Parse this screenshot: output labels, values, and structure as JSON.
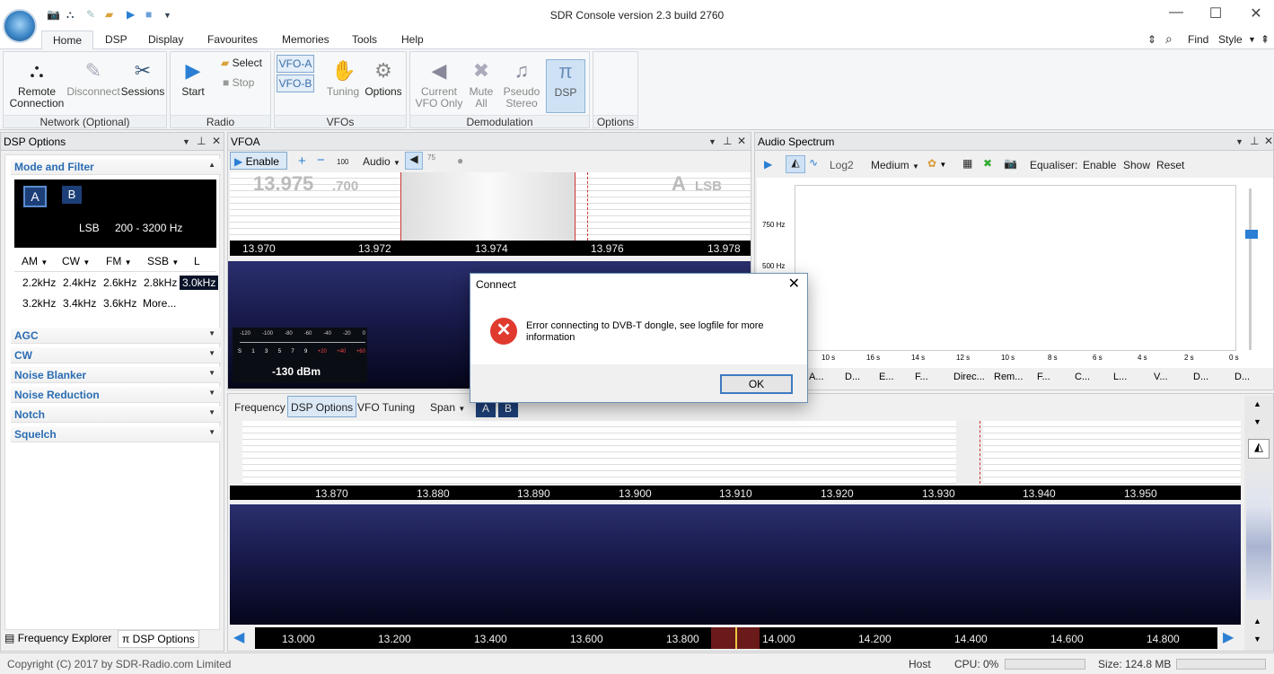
{
  "window": {
    "title": "SDR Console version 2.3 build 2760"
  },
  "quick_access": [
    "camera-icon",
    "network-icon",
    "plug-icon",
    "folder-icon",
    "play-icon",
    "stop-icon",
    "dropdown-icon"
  ],
  "window_controls": {
    "minimize": "—",
    "maximize": "☐",
    "close": "✕"
  },
  "menu": {
    "items": [
      "Home",
      "DSP",
      "Display",
      "Favourites",
      "Memories",
      "Tools",
      "Help"
    ],
    "active": "Home"
  },
  "ribbon_tools": {
    "find": "Find",
    "style": "Style"
  },
  "ribbon": {
    "network": {
      "label": "Network (Optional)",
      "remote": "Remote\nConnection",
      "disconnect": "Disconnect",
      "sessions": "Sessions"
    },
    "radio": {
      "label": "Radio",
      "start": "Start",
      "select": "Select",
      "stop": "Stop"
    },
    "vfos": {
      "label": "VFOs",
      "vfo_a": "VFO-A",
      "vfo_b": "VFO-B",
      "tuning": "Tuning",
      "options": "Options"
    },
    "demod": {
      "label": "Demodulation",
      "current": "Current\nVFO Only",
      "mute": "Mute\nAll",
      "pseudo": "Pseudo\nStereo"
    },
    "dsp": {
      "label": "DSP",
      "btn": "DSP"
    },
    "options": {
      "label": "Options"
    }
  },
  "dsp_options": {
    "title": "DSP Options",
    "mode_filter": "Mode and Filter",
    "vfo_a": "A",
    "vfo_b": "B",
    "mode": "LSB",
    "range": "200 - 3200 Hz",
    "modes": [
      "AM",
      "CW",
      "FM",
      "SSB",
      "L"
    ],
    "bandwidths": [
      "2.2kHz",
      "2.4kHz",
      "2.6kHz",
      "2.8kHz",
      "3.0kHz",
      "3.2kHz",
      "3.4kHz",
      "3.6kHz",
      "More..."
    ],
    "selected_bw": "3.0kHz",
    "sections": [
      "AGC",
      "CW",
      "Noise Blanker",
      "Noise Reduction",
      "Notch",
      "Squelch"
    ],
    "tabs": [
      "Frequency Explorer",
      "DSP Options"
    ]
  },
  "vfoa": {
    "title": "VFOA",
    "enable": "Enable",
    "audio": "Audio",
    "zoom": "100",
    "mini": "75",
    "freq_main": "13.975",
    "freq_sub": ".700",
    "vfo_letter": "A",
    "mode": "LSB",
    "ticks": [
      "13.970",
      "13.972",
      "13.974",
      "13.976",
      "13.978"
    ],
    "meter_scale": [
      "-120",
      "-100",
      "-80",
      "-60",
      "-40",
      "-20",
      "0"
    ],
    "meter_s": [
      "S",
      "1",
      "3",
      "5",
      "7",
      "9",
      "+20",
      "+40",
      "+60"
    ],
    "meter_value": "-130 dBm"
  },
  "audio_spectrum": {
    "title": "Audio Spectrum",
    "log2": "Log2",
    "medium": "Medium",
    "equaliser": "Equaliser:",
    "enable": "Enable",
    "show": "Show",
    "reset": "Reset",
    "yticks": [
      "750 Hz",
      "500 Hz"
    ],
    "xticks": [
      "10 s",
      "16 s",
      "14 s",
      "12 s",
      "10 s",
      "8 s",
      "6 s",
      "4 s",
      "2 s",
      "0 s"
    ],
    "tabs": [
      "A...",
      "D...",
      "E...",
      "F...",
      "Direc...",
      "Rem...",
      "F...",
      "C...",
      "L...",
      "V...",
      "D...",
      "D..."
    ]
  },
  "main_spectrum": {
    "tabs": [
      "Frequency",
      "DSP Options",
      "VFO Tuning",
      "Span"
    ],
    "active_tab": "DSP Options",
    "ab": [
      "A",
      "B"
    ],
    "ticks": [
      "13.870",
      "13.880",
      "13.890",
      "13.900",
      "13.910",
      "13.920",
      "13.930",
      "13.940",
      "13.950"
    ],
    "bottom_ticks": [
      "13.000",
      "13.200",
      "13.400",
      "13.600",
      "13.800",
      "14.000",
      "14.200",
      "14.400",
      "14.600",
      "14.800"
    ]
  },
  "dialog": {
    "title": "Connect",
    "message": "Error connecting to DVB-T dongle, see logfile for more information",
    "ok": "OK"
  },
  "status": {
    "copyright": "Copyright (C) 2017 by SDR-Radio.com Limited",
    "host": "Host",
    "cpu": "CPU: 0%",
    "size": "Size: 124.8 MB"
  }
}
